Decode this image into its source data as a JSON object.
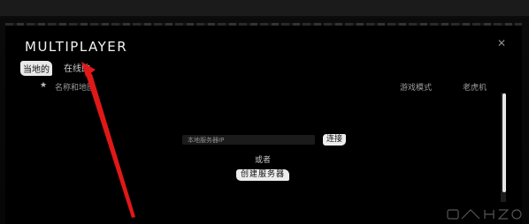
{
  "window": {
    "title": "MULTIPLAYER",
    "close_icon": "close-icon"
  },
  "tabs": [
    {
      "label": "当地的",
      "active": true
    },
    {
      "label": "在线的",
      "active": false
    }
  ],
  "columns": {
    "favorite_icon": "star-icon",
    "name": "名称和地图",
    "mode": "游戏模式",
    "slots": "老虎机"
  },
  "connect": {
    "ip_placeholder": "本地服务器IP",
    "ip_value": "",
    "connect_label": "连接",
    "or_text": "或者",
    "create_label": "创建服务器"
  },
  "annotation": {
    "arrow_color": "#e01818"
  },
  "colors": {
    "background": "#000000",
    "text": "#f2f2f2",
    "highlight": "#ededed"
  }
}
